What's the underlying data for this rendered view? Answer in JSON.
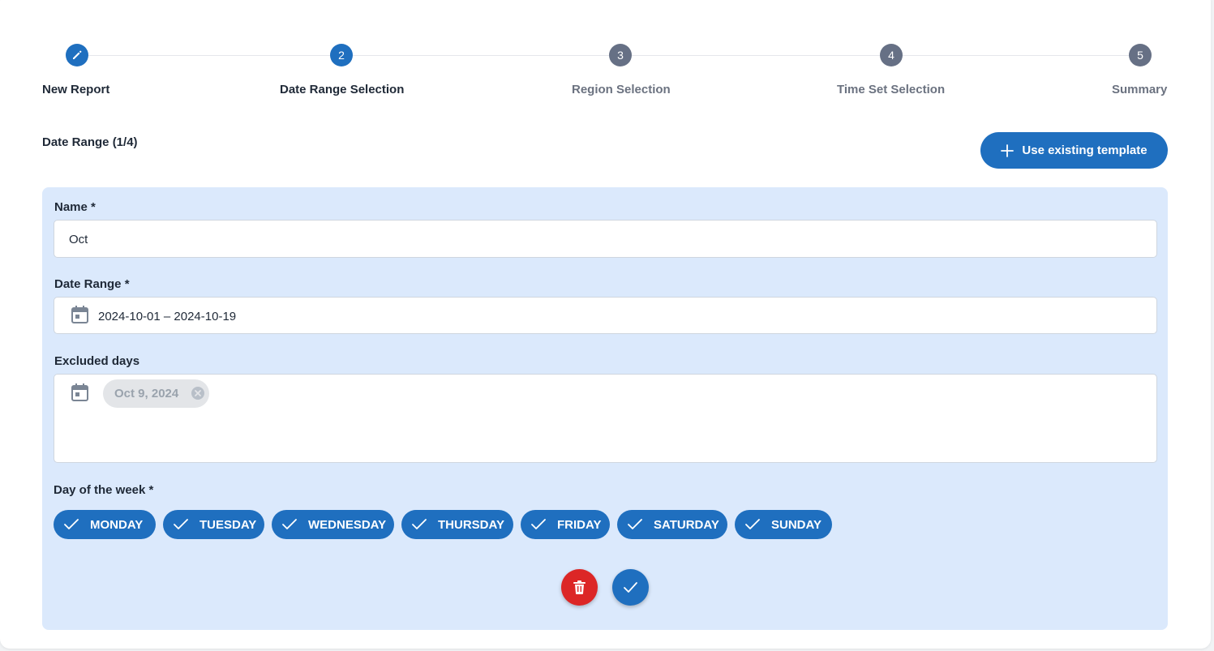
{
  "stepper": {
    "steps": [
      {
        "number": "",
        "label": "New Report",
        "state": "done",
        "icon": "pencil-icon"
      },
      {
        "number": "2",
        "label": "Date Range Selection",
        "state": "active"
      },
      {
        "number": "3",
        "label": "Region Selection",
        "state": "pending"
      },
      {
        "number": "4",
        "label": "Time Set Selection",
        "state": "pending"
      },
      {
        "number": "5",
        "label": "Summary",
        "state": "pending"
      }
    ]
  },
  "section": {
    "title": "Date Range (1/4)"
  },
  "template_button": {
    "label": "Use existing template",
    "icon": "plus-icon"
  },
  "form": {
    "name": {
      "label": "Name *",
      "value": "Oct"
    },
    "date_range": {
      "label": "Date Range *",
      "value": "2024-10-01 – 2024-10-19",
      "icon": "calendar-icon"
    },
    "excluded_days": {
      "label": "Excluded days",
      "icon": "calendar-icon",
      "chips": [
        "Oct 9, 2024"
      ]
    },
    "day_of_week": {
      "label": "Day of the week *",
      "days": [
        "MONDAY",
        "TUESDAY",
        "WEDNESDAY",
        "THURSDAY",
        "FRIDAY",
        "SATURDAY",
        "SUNDAY"
      ],
      "selected": [
        true,
        true,
        true,
        true,
        true,
        true,
        true
      ]
    }
  },
  "actions": {
    "delete_icon": "trash-icon",
    "confirm_icon": "check-icon"
  },
  "colors": {
    "primary": "#1f6fbf",
    "danger": "#dc2626",
    "panel": "#dbe9fc",
    "pending": "#667085"
  }
}
